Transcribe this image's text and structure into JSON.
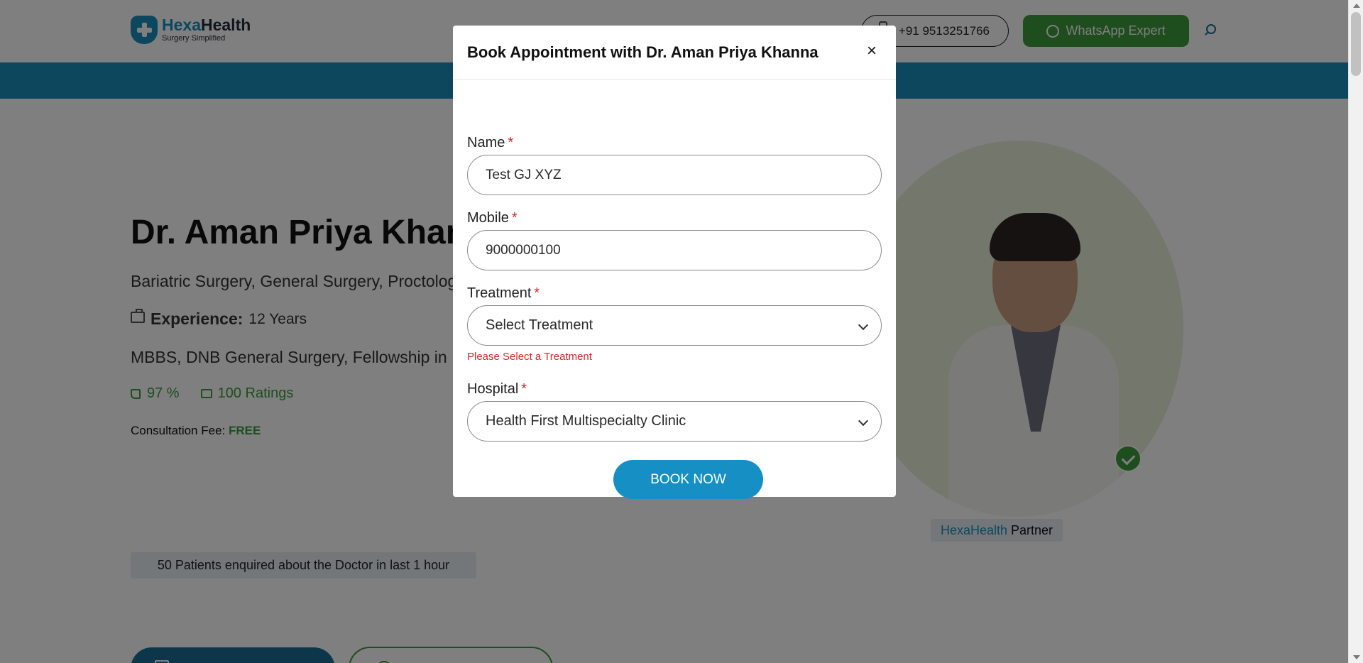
{
  "header": {
    "brand_part1": "Hexa",
    "brand_part2": "Health",
    "tagline": "Surgery Simplified",
    "phone": "+91 9513251766",
    "whatsapp_label": "WhatsApp Expert"
  },
  "doctor": {
    "name": "Dr. Aman Priya Khanna",
    "specialties": "Bariatric Surgery, General Surgery, Proctology",
    "experience_label": "Experience:",
    "experience_value": "12 Years",
    "degrees": "MBBS, DNB General Surgery, Fellowship in",
    "approval": "97 %",
    "ratings": "100 Ratings",
    "fee_label": "Consultation Fee:",
    "fee_value": "FREE",
    "partner_brand": "HexaHealth",
    "partner_label": "Partner",
    "enquiry_text": "50 Patients enquired about the Doctor in last 1 hour"
  },
  "modal": {
    "title": "Book Appointment with Dr. Aman Priya Khanna",
    "close": "×",
    "required_mark": "*",
    "fields": {
      "name": {
        "label": "Name",
        "value": "Test GJ XYZ"
      },
      "mobile": {
        "label": "Mobile",
        "value": "9000000100"
      },
      "treatment": {
        "label": "Treatment",
        "value": "Select Treatment",
        "error": "Please Select a Treatment"
      },
      "hospital": {
        "label": "Hospital",
        "value": "Health First Multispecialty Clinic"
      }
    },
    "submit_label": "BOOK NOW"
  },
  "colors": {
    "brand_blue": "#1a8fbd",
    "whatsapp_green": "#3d9a3d",
    "error_red": "#e02424",
    "book_button": "#168fc4"
  }
}
